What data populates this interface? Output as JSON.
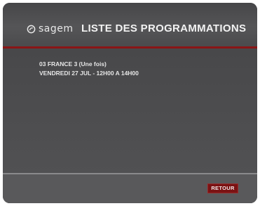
{
  "header": {
    "brand": "sagem",
    "title": "LISTE DES PROGRAMMATIONS"
  },
  "program": {
    "channel_line": "03 FRANCE 3 (Une fois)",
    "schedule_line": "VENDREDI 27 JUL - 12H00 A 14H00"
  },
  "footer": {
    "retour_label": "RETOUR"
  },
  "colors": {
    "accent_red": "#8a1516",
    "button_red": "#7a1213",
    "background": "#4a4a4c"
  }
}
